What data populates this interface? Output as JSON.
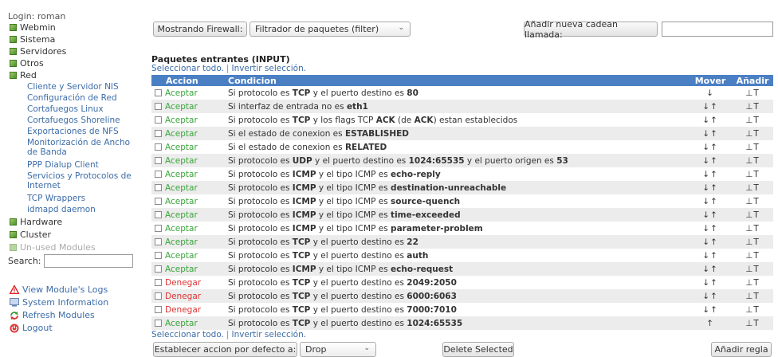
{
  "sidebar": {
    "login": "Login: roman",
    "categories": [
      {
        "label": "Webmin"
      },
      {
        "label": "Sistema"
      },
      {
        "label": "Servidores"
      },
      {
        "label": "Otros"
      },
      {
        "label": "Red"
      },
      {
        "label": "Hardware"
      },
      {
        "label": "Cluster"
      },
      {
        "label": "Un-used Modules"
      }
    ],
    "red_items": [
      "Cliente y Servidor NIS",
      "Configuración de Red",
      "Cortafuegos Linux",
      "Cortafuegos Shoreline",
      "Exportaciones de NFS",
      "Monitorización de Ancho de Banda",
      "PPP Dialup Client",
      "Servicios y Protocolos de Internet",
      "TCP Wrappers",
      "idmapd daemon"
    ],
    "search_label": "Search:",
    "search_value": "",
    "footer": [
      {
        "label": "View Module's Logs",
        "icon": "warning-icon"
      },
      {
        "label": "System Information",
        "icon": "info-icon"
      },
      {
        "label": "Refresh Modules",
        "icon": "refresh-icon"
      },
      {
        "label": "Logout",
        "icon": "logout-icon"
      }
    ]
  },
  "toolbar": {
    "show_button": "Mostrando Firewall:",
    "table_select": "Filtrador de paquetes (filter)",
    "add_chain_button": "Añadir nueva cadean llamada:",
    "add_chain_value": ""
  },
  "section": {
    "title": "Paquetes entrantes (INPUT)",
    "select_all": "Seleccionar todo.",
    "invert": "Invertir selección."
  },
  "table": {
    "headers": {
      "action": "Accion",
      "condition": "Condicion",
      "move": "Mover",
      "add": "Añadir"
    },
    "rows": [
      {
        "action": "Aceptar",
        "kind": "accept",
        "move": "down",
        "parts": [
          [
            "Si protocolo es ",
            ""
          ],
          [
            "TCP",
            "b"
          ],
          [
            " y el puerto destino es ",
            ""
          ],
          [
            "80",
            "b"
          ]
        ]
      },
      {
        "action": "Aceptar",
        "kind": "accept",
        "move": "both",
        "parts": [
          [
            "Si interfaz de entrada no es ",
            ""
          ],
          [
            "eth1",
            "b"
          ]
        ]
      },
      {
        "action": "Aceptar",
        "kind": "accept",
        "move": "both",
        "parts": [
          [
            "Si protocolo es ",
            ""
          ],
          [
            "TCP",
            "b"
          ],
          [
            " y los flags TCP ",
            ""
          ],
          [
            "ACK",
            "b"
          ],
          [
            " (de ",
            ""
          ],
          [
            "ACK",
            "b"
          ],
          [
            ") estan establecidos",
            ""
          ]
        ]
      },
      {
        "action": "Aceptar",
        "kind": "accept",
        "move": "both",
        "parts": [
          [
            "Si el estado de conexion es ",
            ""
          ],
          [
            "ESTABLISHED",
            "b"
          ]
        ]
      },
      {
        "action": "Aceptar",
        "kind": "accept",
        "move": "both",
        "parts": [
          [
            "Si el estado de conexion es ",
            ""
          ],
          [
            "RELATED",
            "b"
          ]
        ]
      },
      {
        "action": "Aceptar",
        "kind": "accept",
        "move": "both",
        "parts": [
          [
            "Si protocolo es ",
            ""
          ],
          [
            "UDP",
            "b"
          ],
          [
            " y el puerto destino es ",
            ""
          ],
          [
            "1024:65535",
            "b"
          ],
          [
            " y el puerto origen es ",
            ""
          ],
          [
            "53",
            "b"
          ]
        ]
      },
      {
        "action": "Aceptar",
        "kind": "accept",
        "move": "both",
        "parts": [
          [
            "Si protocolo es ",
            ""
          ],
          [
            "ICMP",
            "b"
          ],
          [
            " y el tipo ICMP es ",
            ""
          ],
          [
            "echo-reply",
            "b"
          ]
        ]
      },
      {
        "action": "Aceptar",
        "kind": "accept",
        "move": "both",
        "parts": [
          [
            "Si protocolo es ",
            ""
          ],
          [
            "ICMP",
            "b"
          ],
          [
            " y el tipo ICMP es ",
            ""
          ],
          [
            "destination-unreachable",
            "b"
          ]
        ]
      },
      {
        "action": "Aceptar",
        "kind": "accept",
        "move": "both",
        "parts": [
          [
            "Si protocolo es ",
            ""
          ],
          [
            "ICMP",
            "b"
          ],
          [
            " y el tipo ICMP es ",
            ""
          ],
          [
            "source-quench",
            "b"
          ]
        ]
      },
      {
        "action": "Aceptar",
        "kind": "accept",
        "move": "both",
        "parts": [
          [
            "Si protocolo es ",
            ""
          ],
          [
            "ICMP",
            "b"
          ],
          [
            " y el tipo ICMP es ",
            ""
          ],
          [
            "time-exceeded",
            "b"
          ]
        ]
      },
      {
        "action": "Aceptar",
        "kind": "accept",
        "move": "both",
        "parts": [
          [
            "Si protocolo es ",
            ""
          ],
          [
            "ICMP",
            "b"
          ],
          [
            " y el tipo ICMP es ",
            ""
          ],
          [
            "parameter-problem",
            "b"
          ]
        ]
      },
      {
        "action": "Aceptar",
        "kind": "accept",
        "move": "both",
        "parts": [
          [
            "Si protocolo es ",
            ""
          ],
          [
            "TCP",
            "b"
          ],
          [
            " y el puerto destino es ",
            ""
          ],
          [
            "22",
            "b"
          ]
        ]
      },
      {
        "action": "Aceptar",
        "kind": "accept",
        "move": "both",
        "parts": [
          [
            "Si protocolo es ",
            ""
          ],
          [
            "TCP",
            "b"
          ],
          [
            " y el puerto destino es ",
            ""
          ],
          [
            "auth",
            "b"
          ]
        ]
      },
      {
        "action": "Aceptar",
        "kind": "accept",
        "move": "both",
        "parts": [
          [
            "Si protocolo es ",
            ""
          ],
          [
            "ICMP",
            "b"
          ],
          [
            " y el tipo ICMP es ",
            ""
          ],
          [
            "echo-request",
            "b"
          ]
        ]
      },
      {
        "action": "Denegar",
        "kind": "deny",
        "move": "both",
        "parts": [
          [
            "Si protocolo es ",
            ""
          ],
          [
            "TCP",
            "b"
          ],
          [
            " y el puerto destino es ",
            ""
          ],
          [
            "2049:2050",
            "b"
          ]
        ]
      },
      {
        "action": "Denegar",
        "kind": "deny",
        "move": "both",
        "parts": [
          [
            "Si protocolo es ",
            ""
          ],
          [
            "TCP",
            "b"
          ],
          [
            " y el puerto destino es ",
            ""
          ],
          [
            "6000:6063",
            "b"
          ]
        ]
      },
      {
        "action": "Denegar",
        "kind": "deny",
        "move": "both",
        "parts": [
          [
            "Si protocolo es ",
            ""
          ],
          [
            "TCP",
            "b"
          ],
          [
            " y el puerto destino es ",
            ""
          ],
          [
            "7000:7010",
            "b"
          ]
        ]
      },
      {
        "action": "Aceptar",
        "kind": "accept",
        "move": "up",
        "parts": [
          [
            "Si protocolo es ",
            ""
          ],
          [
            "TCP",
            "b"
          ],
          [
            " y el puerto destino es ",
            ""
          ],
          [
            "1024:65535",
            "b"
          ]
        ]
      }
    ]
  },
  "bottom": {
    "default_button": "Establecer accion por defecto a:",
    "default_select": "Drop",
    "delete_button": "Delete Selected",
    "add_rule_button": "Añadir regla"
  },
  "glyphs": {
    "down": "↓",
    "up": "↑",
    "add_below": "⊥",
    "add_above": "T"
  },
  "colors": {
    "header_bg": "#4b7fc3",
    "accept": "#3aa53a",
    "deny": "#dd3333",
    "link": "#3c6ca8"
  }
}
